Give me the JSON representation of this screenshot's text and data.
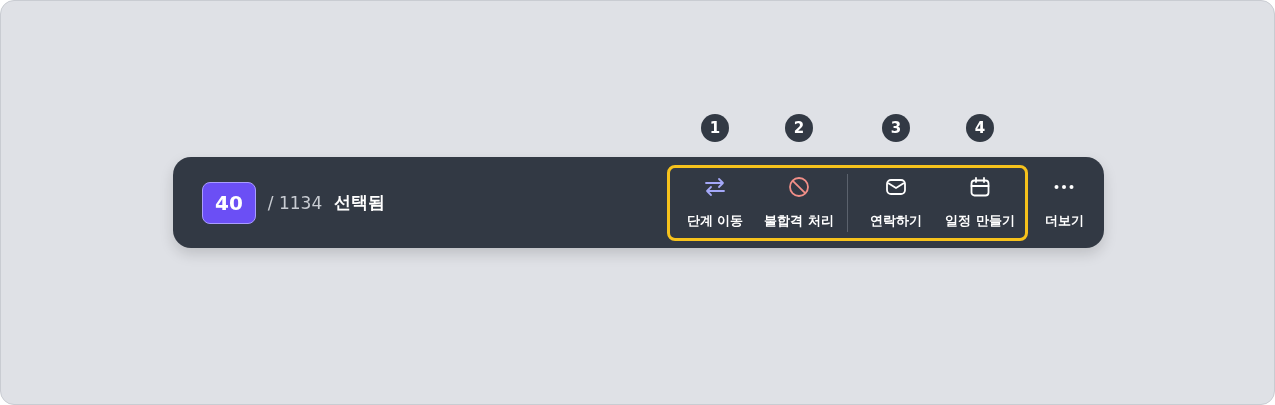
{
  "selection": {
    "count": "40",
    "total": "/ 1134",
    "label": "선택됨"
  },
  "action_groups": [
    {
      "actions": [
        {
          "marker": "1",
          "label": "단계 이동",
          "kind": "swap"
        },
        {
          "marker": "2",
          "label": "불합격 처리",
          "kind": "ban"
        }
      ]
    },
    {
      "actions": [
        {
          "marker": "3",
          "label": "연락하기",
          "kind": "mail"
        },
        {
          "marker": "4",
          "label": "일정 만들기",
          "kind": "calendar"
        }
      ]
    }
  ],
  "more": {
    "label": "더보기",
    "kind": "dots"
  }
}
